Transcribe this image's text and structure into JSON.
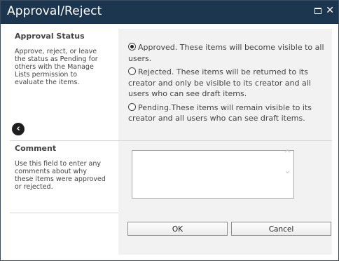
{
  "window": {
    "title": "Approval/Reject"
  },
  "approval_status": {
    "title": "Approval Status",
    "description": "Approve, reject, or leave the status as Pending for others with the Manage Lists permission to evaluate the items.",
    "options": [
      {
        "label": "Approved. These items will become visible to all users.",
        "selected": true
      },
      {
        "label": "Rejected. These items will be returned to its creator and only be visible to its creator and all users who can see draft items.",
        "selected": false
      },
      {
        "label": "Pending.These items will remain visible to its creator and all users who can see draft items.",
        "selected": false
      }
    ]
  },
  "comment": {
    "title": "Comment",
    "description": "Use this field to enter any comments about why these items were approved or rejected.",
    "value": ""
  },
  "buttons": {
    "ok": "OK",
    "cancel": "Cancel"
  }
}
